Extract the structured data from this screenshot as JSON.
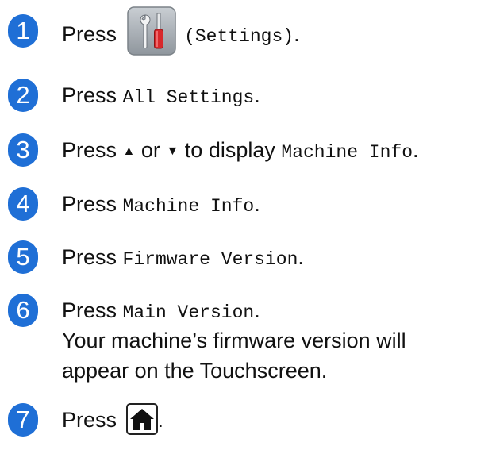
{
  "steps": [
    {
      "num": "1",
      "press": "Press",
      "mono": "(Settings)",
      "trail": "."
    },
    {
      "num": "2",
      "press": "Press",
      "mono": "All Settings",
      "trail": "."
    },
    {
      "num": "3",
      "press": "Press",
      "up": "▲",
      "or": "or",
      "down": "▼",
      "to_display": "to display",
      "mono": "Machine Info",
      "trail": "."
    },
    {
      "num": "4",
      "press": "Press",
      "mono": "Machine Info",
      "trail": "."
    },
    {
      "num": "5",
      "press": "Press",
      "mono": "Firmware Version",
      "trail": "."
    },
    {
      "num": "6",
      "press": "Press",
      "mono": "Main Version",
      "trail": ".",
      "line2": "Your machine’s firmware version will",
      "line3": "appear on the Touchscreen."
    },
    {
      "num": "7",
      "press": "Press",
      "trail": "."
    }
  ],
  "icons": {
    "settings": "settings-icon",
    "home": "home-icon"
  },
  "colors": {
    "badge": "#1f6fd6",
    "text": "#111111"
  }
}
